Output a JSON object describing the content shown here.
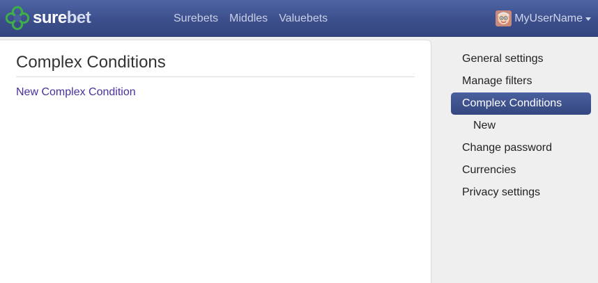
{
  "brand": {
    "name_part1": "sure",
    "name_part2": "bet",
    "logo_icon": "clover-icon",
    "logo_color": "#3fae49"
  },
  "nav": {
    "links": [
      {
        "label": "Surebets"
      },
      {
        "label": "Middles"
      },
      {
        "label": "Valuebets"
      }
    ]
  },
  "user": {
    "name": "MyUserName",
    "avatar_icon": "user-avatar-icon"
  },
  "main": {
    "title": "Complex Conditions",
    "link_label": "New Complex Condition"
  },
  "sidebar": {
    "items": [
      {
        "label": "General settings",
        "active": false
      },
      {
        "label": "Manage filters",
        "active": false
      },
      {
        "label": "Complex Conditions",
        "active": true
      },
      {
        "label": "New",
        "active": false,
        "sub": true
      },
      {
        "label": "Change password",
        "active": false
      },
      {
        "label": "Currencies",
        "active": false
      },
      {
        "label": "Privacy settings",
        "active": false
      }
    ]
  },
  "colors": {
    "navbar": "#3c4f8c",
    "active_item": "#3e5290",
    "link": "#4a2f9a"
  }
}
